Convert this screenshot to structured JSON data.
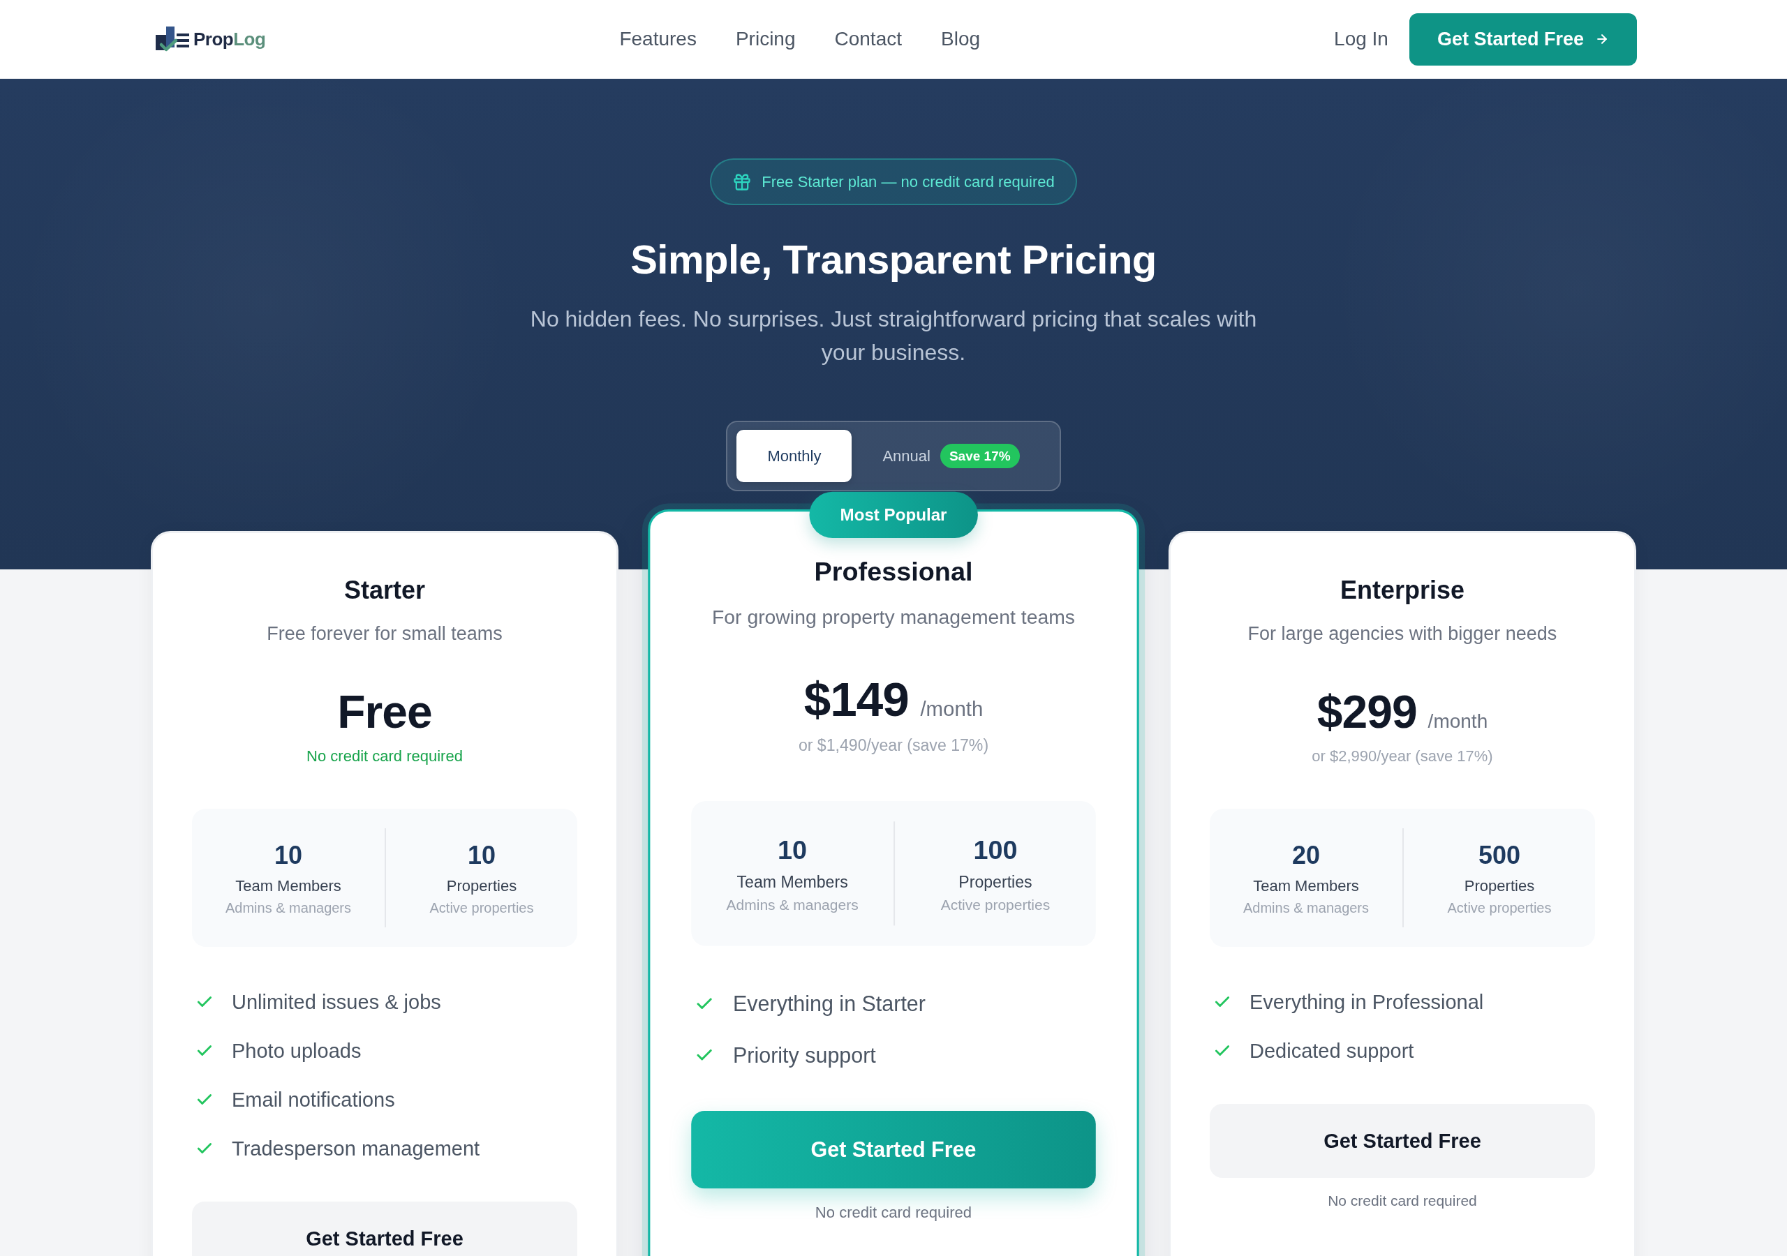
{
  "header": {
    "logo": [
      "Prop",
      "Log"
    ],
    "nav": [
      "Features",
      "Pricing",
      "Contact",
      "Blog"
    ],
    "login": "Log In",
    "cta": "Get Started Free"
  },
  "hero": {
    "badge": "Free Starter plan — no credit card required",
    "title": "Simple, Transparent Pricing",
    "subtitle": "No hidden fees. No surprises. Just straightforward pricing that scales with your business.",
    "billing_toggle": [
      {
        "label": "Monthly",
        "selected": true
      },
      {
        "label": "Annual",
        "selected": false,
        "tag": "Save 17%"
      }
    ]
  },
  "plans": [
    {
      "name": "Starter",
      "featured": false,
      "description": "Free forever for small teams",
      "price": "Free",
      "price_note": {
        "text": "No credit card required",
        "highlighted": true
      },
      "stats": [
        {
          "value": "10",
          "label": "Team Members",
          "detail": "Admins & managers"
        },
        {
          "value": "10",
          "label": "Properties",
          "detail": "Active properties"
        }
      ],
      "features": [
        "Unlimited issues & jobs",
        "Photo uploads",
        "Email notifications",
        "Tradesperson management"
      ],
      "button": "Get Started Free"
    },
    {
      "name": "Professional",
      "featured": true,
      "badge": "Most Popular",
      "description": "For growing property management teams",
      "price": "$149",
      "period": "/month",
      "price_note": {
        "text": "or $1,490/year (save 17%)",
        "highlighted": false
      },
      "stats": [
        {
          "value": "10",
          "label": "Team Members",
          "detail": "Admins & managers"
        },
        {
          "value": "100",
          "label": "Properties",
          "detail": "Active properties"
        }
      ],
      "features": [
        "Everything in Starter",
        "Priority support"
      ],
      "button": "Get Started Free",
      "note": "No credit card required"
    },
    {
      "name": "Enterprise",
      "featured": false,
      "description": "For large agencies with bigger needs",
      "price": "$299",
      "period": "/month",
      "price_note": {
        "text": "or $2,990/year (save 17%)",
        "highlighted": false
      },
      "stats": [
        {
          "value": "20",
          "label": "Team Members",
          "detail": "Admins & managers"
        },
        {
          "value": "500",
          "label": "Properties",
          "detail": "Active properties"
        }
      ],
      "features": [
        "Everything in Professional",
        "Dedicated support"
      ],
      "button": "Get Started Free",
      "note": "No credit card required"
    }
  ]
}
